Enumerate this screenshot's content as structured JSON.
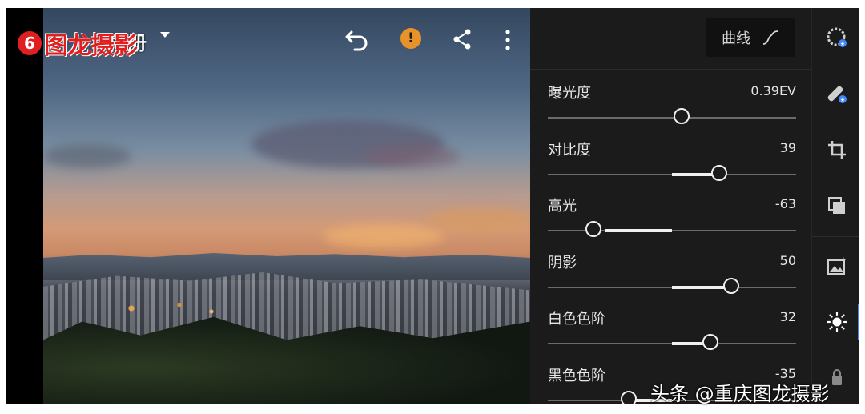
{
  "app": {
    "back_icon": "back-arrow-icon",
    "album_title": "相册",
    "logo_mark": "6",
    "logo_text": "图龙摄影"
  },
  "toolbar": {
    "undo_icon": "undo-icon",
    "warning_icon": "warning-icon",
    "warning_symbol": "!",
    "share_icon": "share-icon",
    "more_icon": "more-vertical-icon",
    "warning_color": "#e8922a"
  },
  "panel": {
    "curve_label": "曲线",
    "curve_icon": "curve-icon",
    "sliders": [
      {
        "label": "曝光度",
        "value": "0.39EV",
        "position": 0.54,
        "fill_from": 0.5,
        "fill_to": 0.5
      },
      {
        "label": "对比度",
        "value": "39",
        "position": 0.69,
        "fill_from": 0.5,
        "fill_to": 0.69
      },
      {
        "label": "高光",
        "value": "-63",
        "position": 0.185,
        "fill_from": 0.23,
        "fill_to": 0.5
      },
      {
        "label": "阴影",
        "value": "50",
        "position": 0.74,
        "fill_from": 0.5,
        "fill_to": 0.74
      },
      {
        "label": "白色色阶",
        "value": "32",
        "position": 0.655,
        "fill_from": 0.5,
        "fill_to": 0.655
      },
      {
        "label": "黑色色阶",
        "value": "-35",
        "position": 0.325,
        "fill_from": 0.325,
        "fill_to": 0.5
      }
    ]
  },
  "rail": {
    "icons": [
      "presets-icon",
      "healing-icon",
      "crop-icon",
      "versions-icon",
      "selective-icon",
      "light-icon",
      "lock-icon"
    ],
    "active": "light-icon",
    "accent": "#3f86ff"
  },
  "watermark": "头条 @重庆图龙摄影"
}
